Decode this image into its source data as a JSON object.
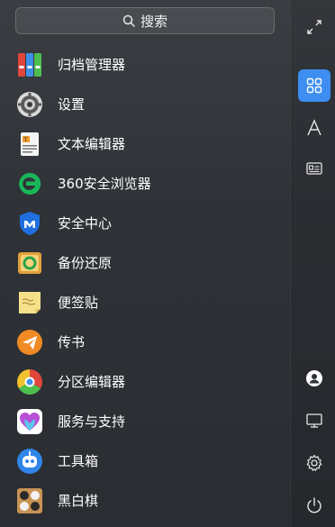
{
  "search": {
    "label": "搜索",
    "icon": "search-icon"
  },
  "apps": [
    {
      "label": "归档管理器",
      "icon": "archive-manager-icon"
    },
    {
      "label": "设置",
      "icon": "settings-gear-icon"
    },
    {
      "label": "文本编辑器",
      "icon": "text-editor-icon"
    },
    {
      "label": "360安全浏览器",
      "icon": "browser-e-icon"
    },
    {
      "label": "安全中心",
      "icon": "security-shield-icon"
    },
    {
      "label": "备份还原",
      "icon": "backup-restore-icon"
    },
    {
      "label": "便签贴",
      "icon": "sticky-note-icon"
    },
    {
      "label": "传书",
      "icon": "paper-plane-icon"
    },
    {
      "label": "分区编辑器",
      "icon": "partition-editor-icon"
    },
    {
      "label": "服务与支持",
      "icon": "support-heart-icon"
    },
    {
      "label": "工具箱",
      "icon": "toolbox-robot-icon"
    },
    {
      "label": "黑白棋",
      "icon": "reversi-board-icon"
    }
  ],
  "sidebar": {
    "items": [
      {
        "icon": "fullscreen-expand-icon",
        "active": false
      },
      {
        "icon": "grid-view-icon",
        "active": true
      },
      {
        "icon": "letter-a-icon",
        "active": false
      },
      {
        "icon": "id-card-icon",
        "active": false
      },
      {
        "icon": "user-icon",
        "active": false
      },
      {
        "icon": "monitor-icon",
        "active": false
      },
      {
        "icon": "gear-icon",
        "active": false
      },
      {
        "icon": "power-icon",
        "active": false
      }
    ]
  },
  "colors": {
    "accent": "#3d8ef0",
    "text": "#ffffff"
  }
}
